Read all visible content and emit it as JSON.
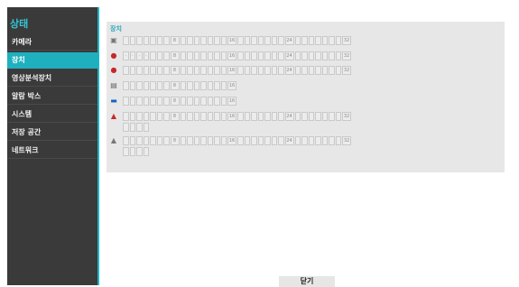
{
  "sidebar": {
    "title": "상태",
    "items": [
      {
        "label": "카메라",
        "active": false
      },
      {
        "label": "장치",
        "active": true
      },
      {
        "label": "영상분석장치",
        "active": false
      },
      {
        "label": "알람 박스",
        "active": false
      },
      {
        "label": "시스템",
        "active": false
      },
      {
        "label": "저장 공간",
        "active": false
      },
      {
        "label": "네트워크",
        "active": false
      }
    ]
  },
  "panel": {
    "title": "장치",
    "rows": [
      {
        "icon": "hdd-icon",
        "count": 32,
        "markers": [
          "8",
          "16",
          "24",
          "32"
        ]
      },
      {
        "icon": "sensor-red-icon",
        "count": 32,
        "markers": [
          "8",
          "16",
          "24",
          "32"
        ],
        "dotted": true
      },
      {
        "icon": "alarm-out-red-icon",
        "count": 32,
        "markers": [
          "8",
          "16",
          "24",
          "32"
        ]
      },
      {
        "icon": "network-card-icon",
        "count": 16,
        "markers": [
          "8",
          "16"
        ]
      },
      {
        "icon": "storage-blue-icon",
        "count": 16,
        "markers": [
          "8",
          "16"
        ]
      },
      {
        "icon": "alarm-red-icon",
        "count": 32,
        "markers": [
          "8",
          "16",
          "24",
          "32"
        ],
        "extra": 4
      },
      {
        "icon": "alarm-gray-icon",
        "count": 32,
        "markers": [
          "8",
          "16",
          "24",
          "32"
        ],
        "extra": 4
      }
    ]
  },
  "footer": {
    "close_label": "닫기"
  },
  "colors": {
    "accent": "#1fb0c0",
    "sidebar_bg": "#3a3a3a",
    "panel_bg": "#e7e7e7"
  }
}
